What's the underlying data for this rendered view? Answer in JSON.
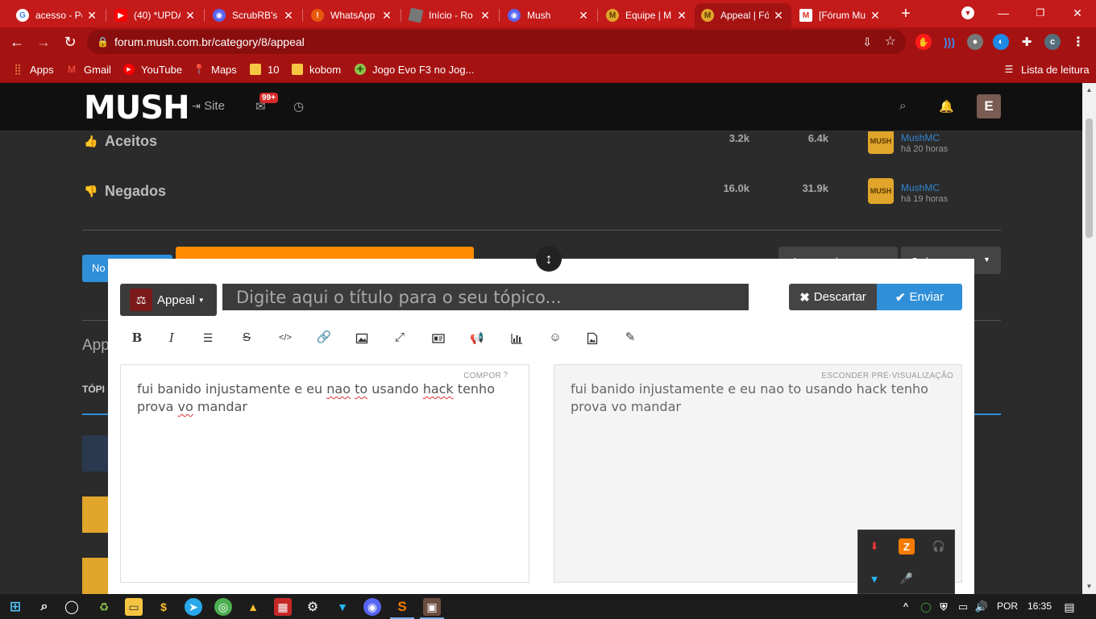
{
  "browser": {
    "tabs": [
      {
        "title": "acesso - Pe",
        "favicon": "google-icon",
        "color": "#ffffff"
      },
      {
        "title": "(40) *UPDA",
        "favicon": "youtube-icon",
        "color": "#ff0000"
      },
      {
        "title": "ScrubRB's",
        "favicon": "discord-icon",
        "color": "#5865f2"
      },
      {
        "title": "WhatsApp",
        "favicon": "whatsapp-icon",
        "color": "#e8590c"
      },
      {
        "title": "Início - Ro",
        "favicon": "roblox-icon",
        "color": "#777777"
      },
      {
        "title": "Mush",
        "favicon": "discord-icon",
        "color": "#5865f2"
      },
      {
        "title": "Equipe | M",
        "favicon": "mush-icon",
        "color": "#e0a52a"
      },
      {
        "title": "Appeal | Fó",
        "favicon": "mush-icon",
        "color": "#e0a52a",
        "active": true
      },
      {
        "title": "[Fórum Mu",
        "favicon": "gmail-icon",
        "color": "#ffffff"
      }
    ],
    "url": "forum.mush.com.br/category/8/appeal",
    "bookmarks": [
      {
        "label": "Apps",
        "icon": "apps-grid-icon"
      },
      {
        "label": "Gmail",
        "icon": "gmail-icon"
      },
      {
        "label": "YouTube",
        "icon": "youtube-icon"
      },
      {
        "label": "Maps",
        "icon": "maps-pin-icon"
      },
      {
        "label": "10",
        "icon": "folder-icon"
      },
      {
        "label": "kobom",
        "icon": "folder-icon"
      },
      {
        "label": "Jogo Evo F3 no Jog...",
        "icon": "game-icon"
      }
    ],
    "reading_list": "Lista de leitura",
    "profile_initial": "c"
  },
  "site": {
    "logo": "MUSH",
    "nav_site": "Site",
    "notification_badge": "99+",
    "user_initial": "E"
  },
  "categories": [
    {
      "name": "Aceitos",
      "topics": "3.2k",
      "posts": "6.4k",
      "last_user": "MushMC",
      "last_time": "há 20 horas",
      "icon": "thumbs-up-icon"
    },
    {
      "name": "Negados",
      "topics": "16.0k",
      "posts": "31.9k",
      "last_user": "MushMC",
      "last_time": "há 19 horas",
      "icon": "thumbs-down-icon"
    }
  ],
  "partial_text": {
    "new_topic": "No",
    "follow": "Acompanhar",
    "sort": "Ordenar por",
    "section": "App",
    "topics_header": "TÓPI"
  },
  "composer": {
    "category": "Appeal",
    "title_placeholder": "Digite aqui o título para o seu tópico...",
    "discard": "Descartar",
    "send": "Enviar",
    "compose_label": "COMPOR",
    "hide_preview_label": "ESCONDER PRÉ-VISUALIZAÇÃO",
    "body_words": [
      "fui banido injustamente e eu ",
      "nao",
      " ",
      "to",
      " usando ",
      "hack",
      "  tenho prova ",
      "vo",
      " mandar"
    ],
    "preview_text": "fui banido injustamente e eu nao to usando hack tenho prova vo mandar"
  },
  "taskbar": {
    "language": "POR",
    "time": "16:35"
  }
}
